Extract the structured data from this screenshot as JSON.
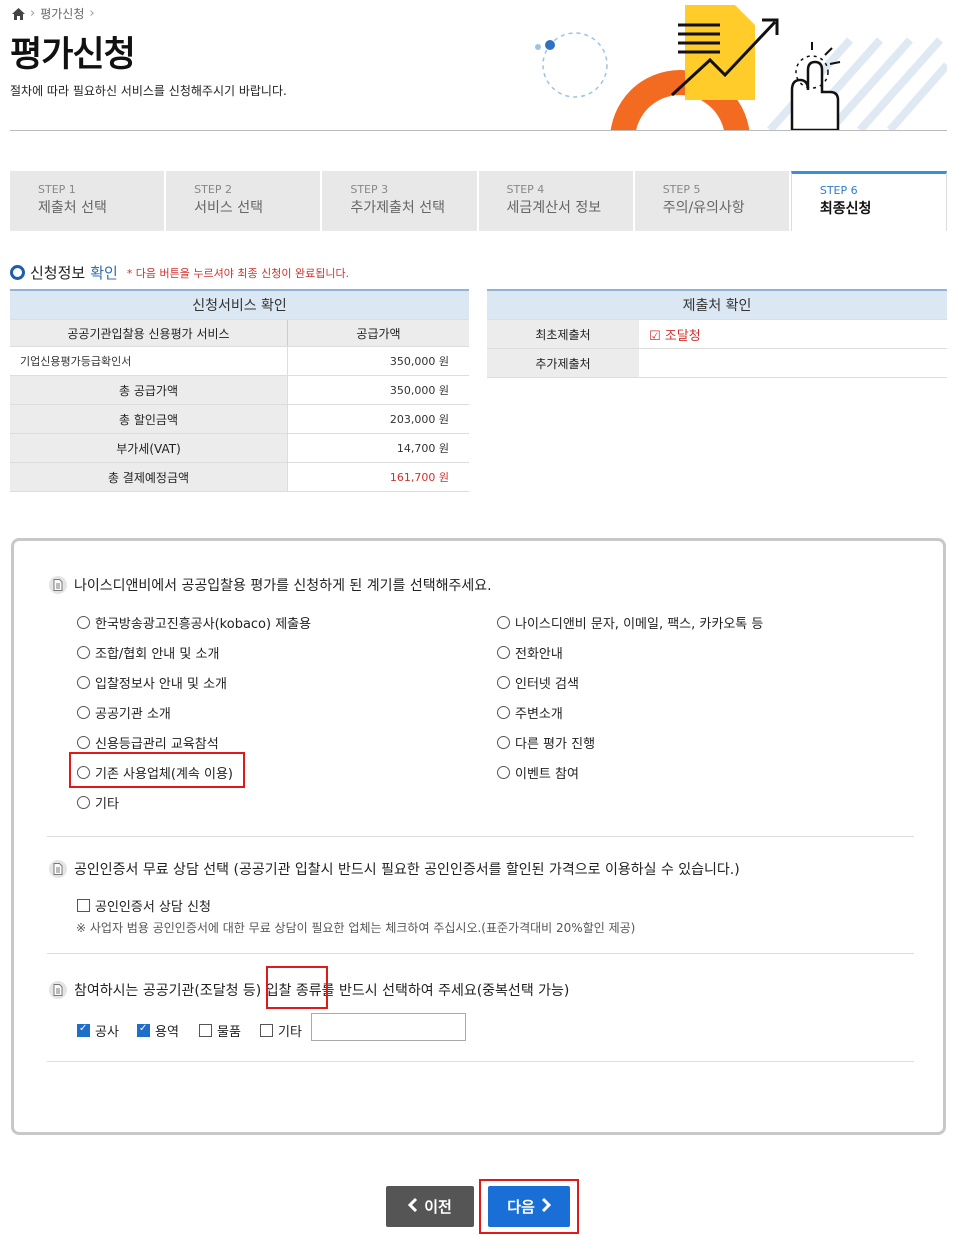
{
  "breadcrumb": {
    "current": "평가신청"
  },
  "header": {
    "title": "평가신청",
    "description": "절차에 따라 필요하신 서비스를 신청해주시기 바랍니다."
  },
  "steps": [
    {
      "num": "STEP 1",
      "label": "제출처 선택"
    },
    {
      "num": "STEP 2",
      "label": "서비스 선택"
    },
    {
      "num": "STEP 3",
      "label": "추가제출처 선택"
    },
    {
      "num": "STEP 4",
      "label": "세금계산서 정보"
    },
    {
      "num": "STEP 5",
      "label": "주의/유의사항"
    },
    {
      "num": "STEP 6",
      "label": "최종신청"
    }
  ],
  "section": {
    "title_part1": "신청정보",
    "title_part2": "확인",
    "note": "* 다음 버튼을 누르셔야 최종 신청이 완료됩니다."
  },
  "service_table": {
    "heading": "신청서비스 확인",
    "col1": "공공기관입찰용 신용평가 서비스",
    "col2": "공급가액",
    "item": {
      "name": "기업신용평가등급확인서",
      "value": "350,000 원"
    },
    "rows": [
      {
        "label": "총 공급가액",
        "value": "350,000 원"
      },
      {
        "label": "총 할인금액",
        "value": "203,000 원"
      },
      {
        "label": "부가세(VAT)",
        "value": "14,700 원"
      },
      {
        "label": "총 결제예정금액",
        "value": "161,700 원"
      }
    ]
  },
  "submit_table": {
    "heading": "제출처 확인",
    "row1_label": "최초제출처",
    "row1_value": "조달청",
    "row2_label": "추가제출처",
    "row2_value": ""
  },
  "q1": {
    "title": "나이스디앤비에서 공공입찰용 평가를 신청하게 된 계기를 선택해주세요.",
    "left_options": [
      "한국방송광고진흥공사(kobaco) 제출용",
      "조합/협회 안내 및 소개",
      "입찰정보사 안내 및 소개",
      "공공기관 소개",
      "신용등급관리 교육참석",
      "기존 사용업체(계속 이용)",
      "기타"
    ],
    "right_options": [
      "나이스디앤비 문자, 이메일, 팩스, 카카오톡 등",
      "전화안내",
      "인터넷 검색",
      "주변소개",
      "다른 평가 진행",
      "이벤트 참여"
    ]
  },
  "q2": {
    "title": "공인인증서 무료 상담 선택 (공공기관 입찰시 반드시 필요한 공인인증서를 할인된 가격으로 이용하실 수 있습니다.)",
    "checkbox_label": "공인인증서 상담 신청",
    "note": "※ 사업자 범용 공인인증서에 대한 무료 상담이 필요한 업체는 체크하여 주십시오.(표준가격대비 20%할인 제공)"
  },
  "q3": {
    "title": "참여하시는 공공기관(조달청 등) 입찰 종류를 반드시 선택하여 주세요(중복선택 가능)",
    "options": [
      {
        "label": "공사",
        "checked": true
      },
      {
        "label": "용역",
        "checked": true
      },
      {
        "label": "물품",
        "checked": false
      },
      {
        "label": "기타",
        "checked": false
      }
    ],
    "etc_value": ""
  },
  "buttons": {
    "prev": "이전",
    "next": "다음"
  },
  "colors": {
    "accent": "#1a6fd6",
    "highlight": "#e01919",
    "total": "#d0312d"
  }
}
